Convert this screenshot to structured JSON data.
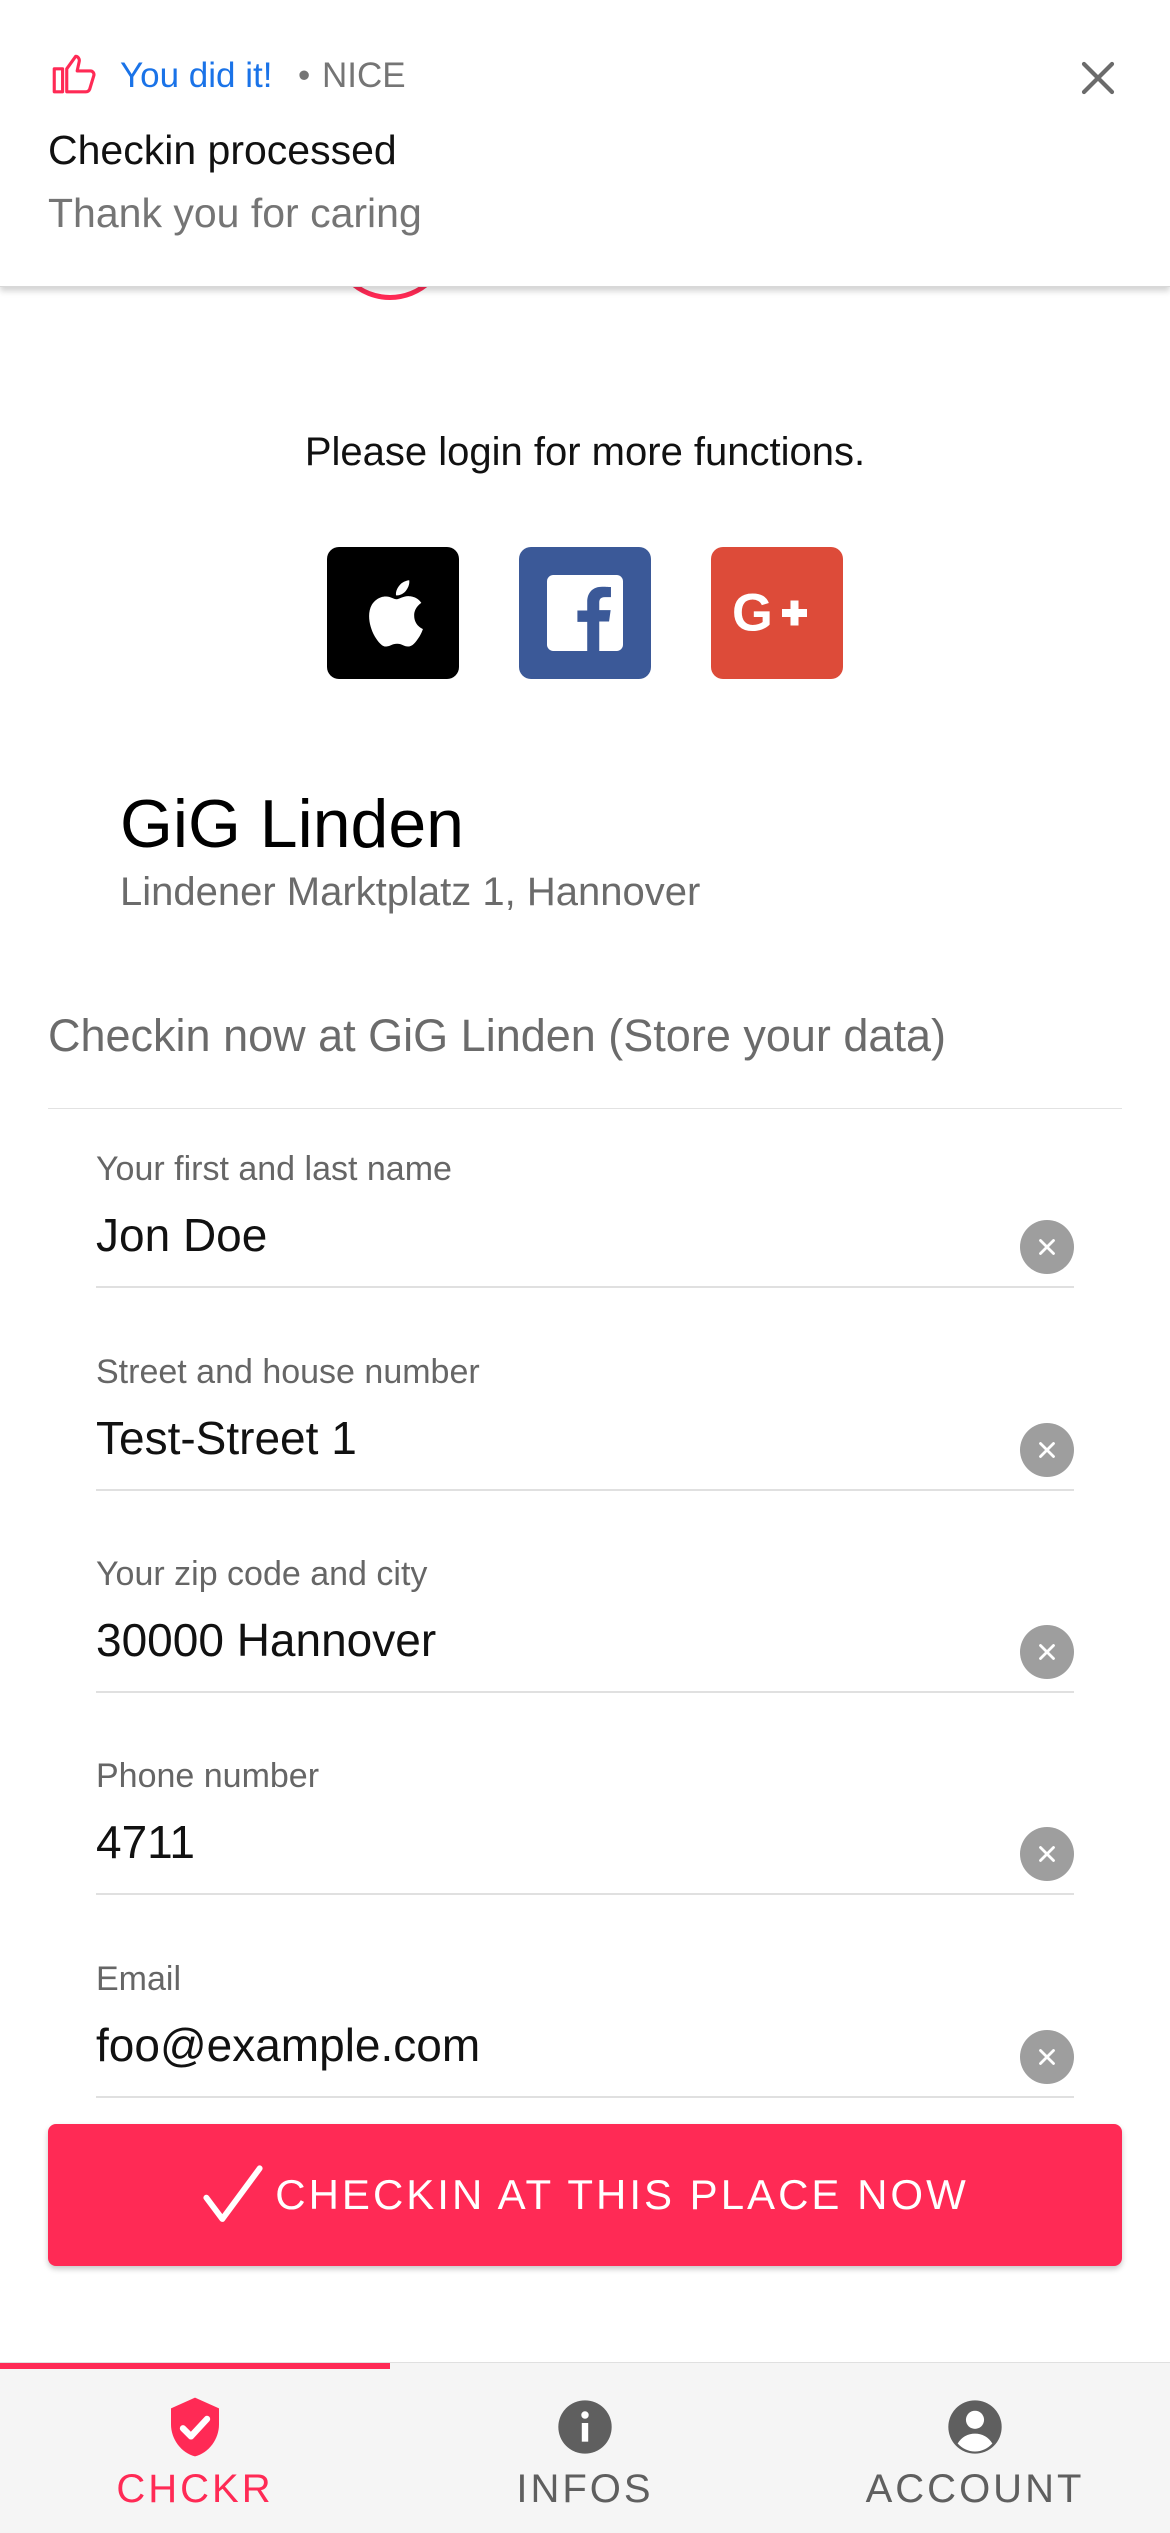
{
  "notification": {
    "app_name": "You did it!",
    "separator": "•",
    "tag": "NICE",
    "title": "Checkin processed",
    "body": "Thank you for caring"
  },
  "login": {
    "prompt": "Please login for more functions.",
    "providers": [
      "apple-icon",
      "facebook-icon",
      "google-plus-icon"
    ]
  },
  "venue": {
    "name": "GiG Linden",
    "address": "Lindener Marktplatz 1, Hannover"
  },
  "checkin": {
    "title": "Checkin now at GiG Linden (Store your data)",
    "fields": [
      {
        "label": "Your first and last name",
        "value": "Jon Doe"
      },
      {
        "label": "Street and house number",
        "value": "Test-Street 1"
      },
      {
        "label": "Your zip code and city",
        "value": "30000 Hannover"
      },
      {
        "label": "Phone number",
        "value": "4711"
      },
      {
        "label": "Email",
        "value": "foo@example.com"
      }
    ],
    "submit_label": "CHECKIN AT THIS PLACE NOW"
  },
  "tabs": [
    {
      "label": "CHCKR",
      "icon": "shield-check-icon",
      "active": true
    },
    {
      "label": "INFOS",
      "icon": "info-icon",
      "active": false
    },
    {
      "label": "ACCOUNT",
      "icon": "account-circle-icon",
      "active": false
    }
  ],
  "colors": {
    "accent": "#ff2a55",
    "link_blue": "#1a73e8",
    "facebook": "#3b5998",
    "google": "#dd4b39",
    "inactive_tab": "#5f5f5f"
  }
}
